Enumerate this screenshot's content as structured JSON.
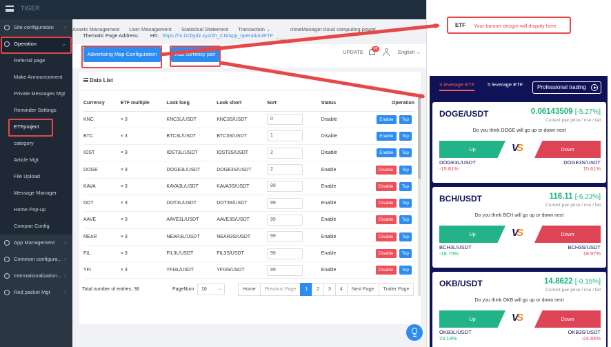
{
  "topbar": {
    "brand": "TIGER"
  },
  "sidebar": {
    "items": [
      {
        "label": "Site configuration",
        "type": "group",
        "expand": "›"
      },
      {
        "label": "Operation",
        "type": "active-group",
        "expand": "⌄"
      },
      {
        "label": "Referral page",
        "type": "sub"
      },
      {
        "label": "Make Announcement",
        "type": "sub"
      },
      {
        "label": "Private Messages Mgt",
        "type": "sub"
      },
      {
        "label": "Reminder Settings",
        "type": "sub"
      },
      {
        "label": "ETFproject",
        "type": "sub-selected"
      },
      {
        "label": "category",
        "type": "sub"
      },
      {
        "label": "Article Mgt",
        "type": "sub"
      },
      {
        "label": "File Upload",
        "type": "sub"
      },
      {
        "label": "Message Manager",
        "type": "sub"
      },
      {
        "label": "Home Pop-up",
        "type": "sub"
      },
      {
        "label": "Coinpair Config",
        "type": "sub"
      },
      {
        "label": "App Management",
        "type": "group",
        "expand": "›"
      },
      {
        "label": "Common configura...",
        "type": "group",
        "expand": "›"
      },
      {
        "label": "Internationalization...",
        "type": "group",
        "expand": "›"
      },
      {
        "label": "Red packet Mgt",
        "type": "group",
        "expand": "›"
      }
    ]
  },
  "nav": {
    "tabs": [
      "Assets Management",
      "User Management",
      "Statistical Statement",
      "Transaction ⌄",
      "mineManager",
      "cloud computing power"
    ]
  },
  "thematic": {
    "label": "Thematic Page Address:",
    "hs_label": "H5:",
    "url": "https://m.lzcbydz.xyz/zh_CN/app_operation/ETF",
    "copy": "Copy"
  },
  "toolbar": {
    "adv_button": "Advertising Map Configuration",
    "add_pair_button": "Add currency pair",
    "update": "UPDATE",
    "badge": "88",
    "language": "English ⌵"
  },
  "data_list": {
    "title": "Data List",
    "columns": [
      "Currency",
      "ETF multiple",
      "Look long",
      "Look short",
      "Sort",
      "Status",
      "Operation"
    ],
    "rows": [
      {
        "currency": "KNC",
        "multiple": "× 3",
        "long": "KNC3L/USDT",
        "short": "KNC3S/USDT",
        "sort": "0",
        "status": "Disable",
        "action": "Enable",
        "top": "Top"
      },
      {
        "currency": "BTC",
        "multiple": "× 3",
        "long": "BTC3L/USDT",
        "short": "BTC3S/USDT",
        "sort": "1",
        "status": "Disable",
        "action": "Enable",
        "top": "Top"
      },
      {
        "currency": "IOST",
        "multiple": "× 3",
        "long": "IOST3L/USDT",
        "short": "IOST3S/USDT",
        "sort": "2",
        "status": "Disable",
        "action": "Enable",
        "top": "Top"
      },
      {
        "currency": "DOGE",
        "multiple": "× 3",
        "long": "DOGE3L/USDT",
        "short": "DOGE3S/USDT",
        "sort": "2",
        "status": "Enable",
        "action": "Disable",
        "top": "Top"
      },
      {
        "currency": "KAVA",
        "multiple": "× 3",
        "long": "KAVA3L/USDT",
        "short": "KAVA3S/USDT",
        "sort": "99",
        "status": "Enable",
        "action": "Disable",
        "top": "Top"
      },
      {
        "currency": "DOT",
        "multiple": "× 3",
        "long": "DOT3L/USDT",
        "short": "DOT3S/USDT",
        "sort": "99",
        "status": "Enable",
        "action": "Disable",
        "top": "Top"
      },
      {
        "currency": "AAVE",
        "multiple": "× 3",
        "long": "AAVE3L/USDT",
        "short": "AAVE3S/USDT",
        "sort": "99",
        "status": "Enable",
        "action": "Disable",
        "top": "Top"
      },
      {
        "currency": "NEAR",
        "multiple": "× 3",
        "long": "NEAR3L/USDT",
        "short": "NEAR3S/USDT",
        "sort": "99",
        "status": "Enable",
        "action": "Disable",
        "top": "Top"
      },
      {
        "currency": "FIL",
        "multiple": "× 3",
        "long": "FIL3L/USDT",
        "short": "FIL3S/USDT",
        "sort": "99",
        "status": "Enable",
        "action": "Disable",
        "top": "Top"
      },
      {
        "currency": "YFI",
        "multiple": "× 3",
        "long": "YFI3L/USDT",
        "short": "YFI3S/USDT",
        "sort": "99",
        "status": "Enable",
        "action": "Disable",
        "top": "Top"
      }
    ]
  },
  "footer": {
    "total_label": "Total number of entries:",
    "total_value": "38",
    "pagenum_label": "PageNum",
    "page_size": "10",
    "pager": [
      {
        "label": "Home",
        "state": "normal"
      },
      {
        "label": "Previous Page",
        "state": "dim"
      },
      {
        "label": "1",
        "state": "current"
      },
      {
        "label": "2",
        "state": "normal"
      },
      {
        "label": "3",
        "state": "normal"
      },
      {
        "label": "4",
        "state": "normal"
      },
      {
        "label": "Next Page",
        "state": "normal"
      },
      {
        "label": "Trailer Page",
        "state": "normal"
      }
    ]
  },
  "preview": {
    "banner": {
      "etf": "ETF",
      "message": "Your banner desgin will dispaly here"
    },
    "tabs": [
      "3 leverage ETF",
      "5 leverage ETF"
    ],
    "pro_button": "Professional trading",
    "cards": [
      {
        "pair": "DOGE/USDT",
        "price": "0.06143509",
        "change": "[-5.27%]",
        "sub": "Current pair price / rise / fall",
        "question": "Do you think DOGE will go up or down next",
        "up": "Up",
        "down": "Down",
        "lsym": "DOGE3L/USDT",
        "lpct": "-15.81%",
        "lsign": "neg",
        "rsym": "DOGE3S/USDT",
        "rpct": "15.61%",
        "rsign": "neg"
      },
      {
        "pair": "BCH/USDT",
        "price": "116.11",
        "change": "[-6.23%]",
        "sub": "Current pair price / rise / fall",
        "question": "Do you think BCH will go up or down next",
        "up": "Up",
        "down": "Down",
        "lsym": "BCH3L/USDT",
        "lpct": "-18.75%",
        "lsign": "pos",
        "rsym": "BCH3S/USDT",
        "rpct": "18.97%",
        "rsign": "neg"
      },
      {
        "pair": "OKB/USDT",
        "price": "14.8622",
        "change": "[-0.15%]",
        "sub": "Current pair price / rise / fall",
        "question": "Do you think OKB will go up or down next",
        "up": "Up",
        "down": "Down",
        "lsym": "OKB3L/USDT",
        "lpct": "23.18%",
        "lsign": "pos",
        "rsym": "OKB3S/USDT",
        "rpct": "-24.84%",
        "rsign": "neg"
      }
    ]
  },
  "colors": {
    "accent": "#2d8cf0",
    "annotation": "#e64848",
    "preview_bg": "#0f1257",
    "up": "#22b389",
    "down": "#dd4455"
  }
}
